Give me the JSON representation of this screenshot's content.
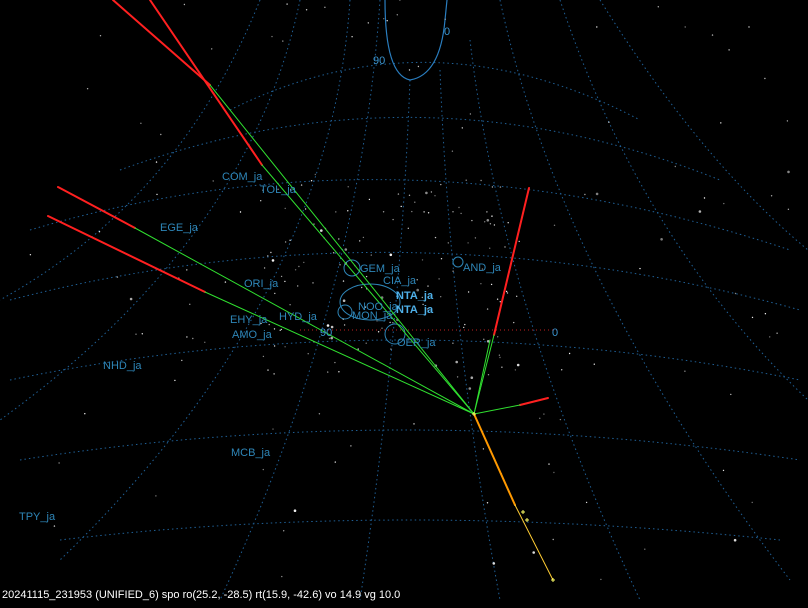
{
  "status_line": "20241115_231953 (UNIFIED_6) spo ro(25.2, -28.5) rt(15.9, -42.6) vo 14.9 vg 10.0",
  "grid_labels": {
    "top_zero": "0",
    "top_ninety": "90",
    "mid_ninety": "90",
    "right_zero": "0"
  },
  "showers": {
    "com": "COM_ja",
    "tol": "TOL_ja",
    "ege": "EGE_ja",
    "gem": "GEM_ja",
    "cia": "CIA_ja",
    "and": "AND_ja",
    "nta1": "NTA_ja",
    "nta2": "NTA_ja",
    "noo": "NOO_ja",
    "mon": "MON_ja",
    "ori": "ORI_ja",
    "ehy": "EHY_ja",
    "hyd": "HYD_ja",
    "amo": "AMO_ja",
    "oer": "OER_ja",
    "nhd": "NHD_ja",
    "mcb": "MCB_ja",
    "tpy": "TPY_ja"
  },
  "colors": {
    "background": "#000000",
    "grid": "#1f5f95",
    "label": "#2e86b8",
    "track_red": "#ff2020",
    "track_green": "#30e030",
    "meteor_orange": "#ff9900",
    "meteor_yellow": "#ffff66"
  }
}
